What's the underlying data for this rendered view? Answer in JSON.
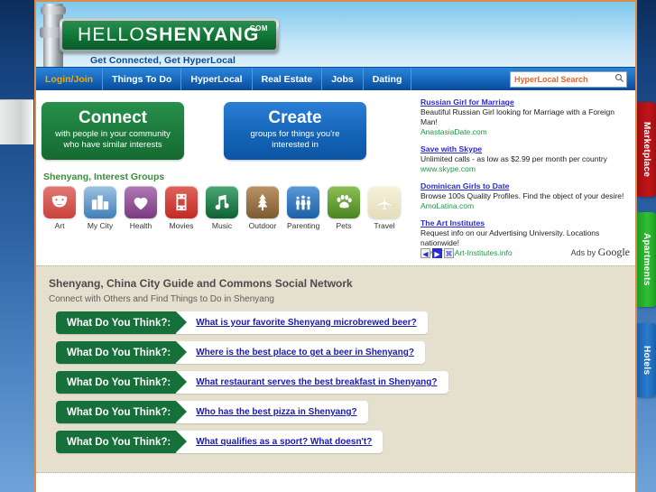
{
  "site": {
    "logo_thin": "HELLO",
    "logo_bold": "SHENYANG",
    "logo_tld": ".COM",
    "tagline": "Get Connected, Get HyperLocal"
  },
  "nav": {
    "items": [
      {
        "label": "Login/Join",
        "active": true
      },
      {
        "label": "Things To Do",
        "active": false
      },
      {
        "label": "HyperLocal",
        "active": false
      },
      {
        "label": "Real Estate",
        "active": false
      },
      {
        "label": "Jobs",
        "active": false
      },
      {
        "label": "Dating",
        "active": false
      }
    ]
  },
  "search": {
    "placeholder": "HyperLocal Search",
    "value": "",
    "icon": "search-icon",
    "text_color": "#e8622a"
  },
  "promos": [
    {
      "title": "Connect",
      "subtitle": "with people in your community who have similar interests",
      "color": "#1c7a3c"
    },
    {
      "title": "Create",
      "subtitle": "groups for things you're interested in",
      "color": "#1464b8"
    }
  ],
  "interest_groups": {
    "label": "Shenyang, Interest Groups",
    "items": [
      {
        "label": "Art",
        "icon": "theater-masks-icon",
        "color": "#d9544f"
      },
      {
        "label": "My City",
        "icon": "city-buildings-icon",
        "color": "#5b93c9"
      },
      {
        "label": "Health",
        "icon": "heart-pulse-icon",
        "color": "#8e4a92"
      },
      {
        "label": "Movies",
        "icon": "film-strip-icon",
        "color": "#d93b34"
      },
      {
        "label": "Music",
        "icon": "music-note-icon",
        "color": "#1d7a4f"
      },
      {
        "label": "Outdoor",
        "icon": "pine-tree-icon",
        "color": "#9a7242"
      },
      {
        "label": "Parenting",
        "icon": "family-people-icon",
        "color": "#2a72bd"
      },
      {
        "label": "Pets",
        "icon": "paw-print-icon",
        "color": "#5c9b28"
      },
      {
        "label": "Travel",
        "icon": "airplane-icon",
        "color": "#efeacb"
      }
    ]
  },
  "ads": {
    "items": [
      {
        "title": "Russian Girl for Marriage",
        "desc": "Beautiful Russian Girl looking for Marriage with a Foreign Man!",
        "url": "AnastasiaDate.com"
      },
      {
        "title": "Save with Skype",
        "desc": "Unlimited calls - as low as $2.99 per month per country",
        "url": "www.skype.com"
      },
      {
        "title": "Dominican Girls to Date",
        "desc": "Browse 100s Quality Profiles. Find the object of your desire!",
        "url": "AmoLatina.com"
      },
      {
        "title": "The Art Institutes",
        "desc": "Request info on our Advertising University. Locations nationwide!",
        "url": "www.The-Art-Institutes.info"
      }
    ],
    "prev_label": "◀",
    "next_label": "▶",
    "info_label": "⌘",
    "attribution_prefix": "Ads by ",
    "attribution_brand": "Google"
  },
  "guide": {
    "heading": "Shenyang, China City Guide and Commons Social Network",
    "subheading": "Connect with Others and Find Things to Do in Shenyang",
    "tag_label": "What Do You Think?:",
    "questions": [
      "What is your favorite Shenyang microbrewed beer?",
      "Where is the best place to get a beer in Shenyang?",
      "What restaurant serves the best breakfast in Shenyang?",
      "Who has the best pizza in Shenyang?",
      "What qualifies as a sport? What doesn't?"
    ]
  },
  "side_tabs": [
    {
      "label": "Marketplace",
      "color": "#c21418"
    },
    {
      "label": "Apartments",
      "color": "#2fc035"
    },
    {
      "label": "Hotels",
      "color": "#2a7ccd"
    }
  ]
}
